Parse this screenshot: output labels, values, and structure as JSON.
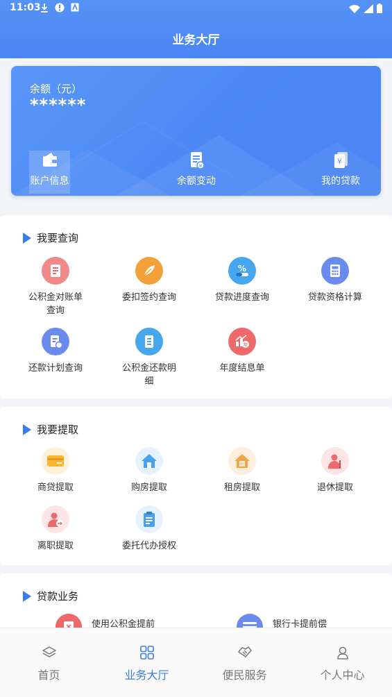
{
  "status_bar": {
    "time": "11:03"
  },
  "header": {
    "title": "业务大厅"
  },
  "balance_card": {
    "label": "余额（元）",
    "value": "******",
    "actions": [
      {
        "label": "账户信息",
        "icon": "wallet-icon"
      },
      {
        "label": "余额变动",
        "icon": "document-yuan-icon"
      },
      {
        "label": "我的贷款",
        "icon": "yuan-card-icon"
      }
    ]
  },
  "query_section": {
    "title": "我要查询",
    "items": [
      {
        "label": "公积金对账单查询",
        "icon": "statement-icon",
        "color": "#ee6a6a"
      },
      {
        "label": "委扣签约查询",
        "icon": "feather-icon",
        "color": "#f5a13b"
      },
      {
        "label": "贷款进度查询",
        "icon": "percent-icon",
        "color": "#46a6ee"
      },
      {
        "label": "贷款资格计算",
        "icon": "calculator-icon",
        "color": "#6b8bec"
      },
      {
        "label": "还款计划查询",
        "icon": "repayment-plan-icon",
        "color": "#6b8bec"
      },
      {
        "label": "公积金还款明细",
        "icon": "list-detail-icon",
        "color": "#46a6ee"
      },
      {
        "label": "年度结息单",
        "icon": "annual-interest-icon",
        "color": "#ee6a6a"
      }
    ]
  },
  "withdraw_section": {
    "title": "我要提取",
    "items": [
      {
        "label": "商贷提取",
        "icon": "card-icon",
        "color": "#f5b830"
      },
      {
        "label": "购房提取",
        "icon": "house-icon",
        "color": "#4aa1ee"
      },
      {
        "label": "租房提取",
        "icon": "rent-house-icon",
        "color": "#f7a342"
      },
      {
        "label": "退休提取",
        "icon": "retiree-icon",
        "color": "#ee6a6a"
      },
      {
        "label": "离职提取",
        "icon": "resign-user-icon",
        "color": "#ee6a6a"
      },
      {
        "label": "委托代办授权",
        "icon": "clipboard-icon",
        "color": "#4aa1ee"
      }
    ]
  },
  "loan_section": {
    "title": "贷款业务",
    "items": [
      {
        "label": "使用公积金提前",
        "icon": "prepay-icon",
        "color": "#ee6a6a"
      },
      {
        "label": "银行卡提前偿",
        "icon": "bank-card-icon",
        "color": "#6b8bec"
      }
    ]
  },
  "tabbar": {
    "tabs": [
      {
        "label": "首页",
        "icon": "layers-icon",
        "active": false
      },
      {
        "label": "业务大厅",
        "icon": "grid-icon",
        "active": true
      },
      {
        "label": "便民服务",
        "icon": "handshake-icon",
        "active": false
      },
      {
        "label": "个人中心",
        "icon": "user-icon",
        "active": false
      }
    ]
  }
}
